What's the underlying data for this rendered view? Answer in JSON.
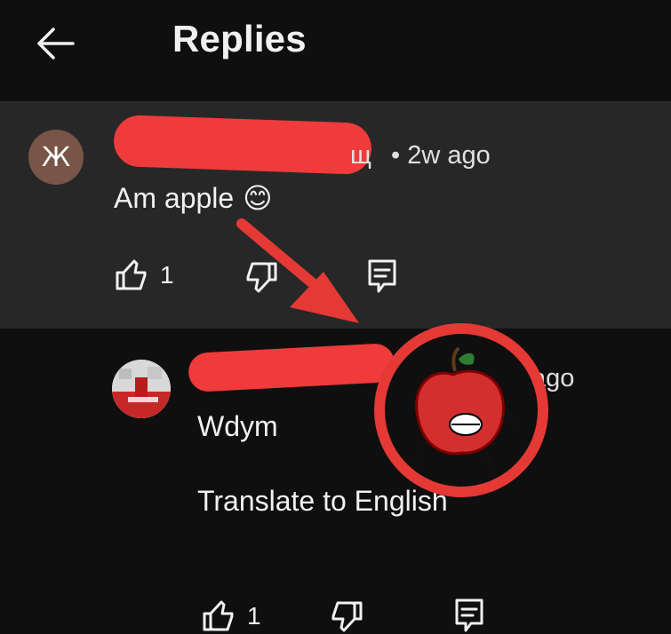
{
  "header": {
    "title": "Replies"
  },
  "parent_comment": {
    "avatar_letter": "Ж",
    "author_suffix": "щ",
    "time": "• 2w ago",
    "text": "Am apple",
    "emoji": "😊",
    "likes": "1"
  },
  "reply": {
    "time_suffix": "ago",
    "text": "Wdym",
    "translate_label": "Translate to English",
    "likes": "1"
  },
  "colors": {
    "background": "#0f0f0f",
    "highlight": "#272727",
    "redaction": "#ef3b3b",
    "annotation": "#e53935"
  }
}
